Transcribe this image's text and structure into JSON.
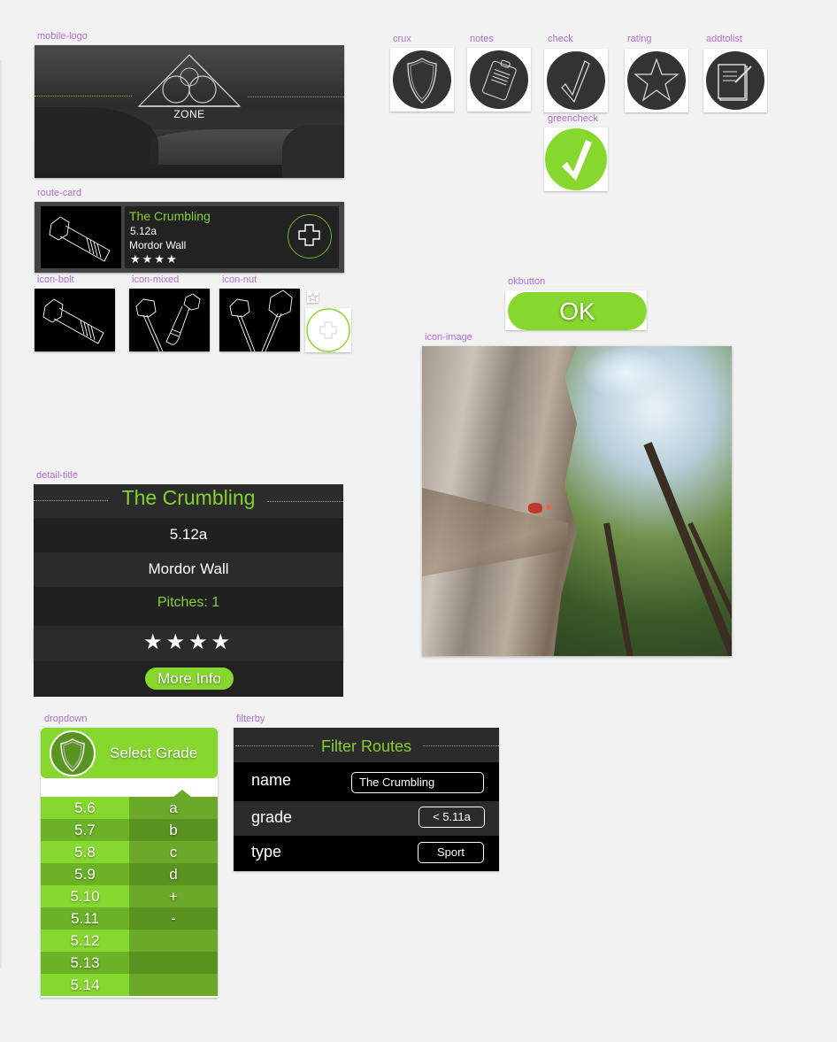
{
  "labels": {
    "mobile_logo": "mobile-logo",
    "crux": "crux",
    "notes": "notes",
    "check": "check",
    "rating": "rating",
    "addtolist": "addtolist",
    "greencheck": "greencheck",
    "route_card": "route-card",
    "icon_bolt": "icon-bolt",
    "icon_mixed": "icon-mixed",
    "icon_nut": "icon-nut",
    "okbutton": "okbutton",
    "icon_image": "icon-image",
    "detail_title": "detail-title",
    "dropdown": "dropdown",
    "filterby": "filterby"
  },
  "logo": {
    "text": "ZONE"
  },
  "route_card": {
    "name": "The Crumbling",
    "grade": "5.12a",
    "wall": "Mordor Wall",
    "stars": "★★★★",
    "rating": 4
  },
  "ok_button": {
    "label": "OK"
  },
  "detail": {
    "title": "The Crumbling",
    "grade": "5.12a",
    "wall": "Mordor Wall",
    "pitches": "Pitches: 1",
    "stars": "★★★★",
    "rating": 4,
    "more_info_label": "More Info"
  },
  "dropdown": {
    "title": "Select Grade",
    "grades": [
      "5.6",
      "5.7",
      "5.8",
      "5.9",
      "5.10",
      "5.11",
      "5.12",
      "5.13",
      "5.14"
    ],
    "letters": [
      "a",
      "b",
      "c",
      "d",
      "+",
      "-",
      "",
      "",
      ""
    ]
  },
  "filter": {
    "title": "Filter Routes",
    "name_label": "name",
    "name_value": "The Crumbling",
    "grade_label": "grade",
    "grade_value": "< 5.11a",
    "type_label": "type",
    "type_value": "Sport"
  },
  "colors": {
    "accent_green": "#87d82e",
    "title_green": "#85d12e",
    "dark_bg": "#222222",
    "label_purple": "#b36fd0"
  }
}
